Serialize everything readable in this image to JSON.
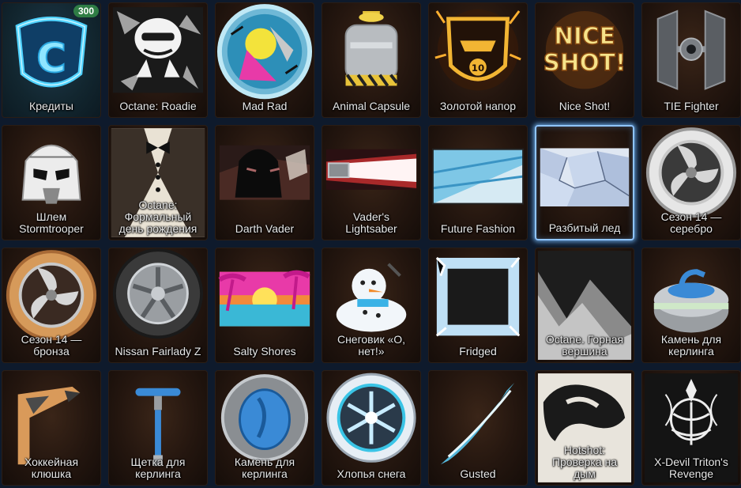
{
  "items": [
    {
      "label": "Кредиты",
      "badge": "300",
      "icon": "credits-shield-icon"
    },
    {
      "label": "Octane: Roadie",
      "icon": "roadie-decal-icon"
    },
    {
      "label": "Mad Rad",
      "icon": "mad-rad-wheel-icon"
    },
    {
      "label": "Animal Capsule",
      "icon": "animal-capsule-icon"
    },
    {
      "label": "Золотой напор",
      "icon": "golden-banner-icon"
    },
    {
      "label": "Nice Shot!",
      "icon": "nice-shot-icon"
    },
    {
      "label": "TIE Fighter",
      "icon": "tie-fighter-icon"
    },
    {
      "label": "Шлем\nStormtrooper",
      "icon": "stormtrooper-helmet-icon"
    },
    {
      "label": "Octane:\nФормальный\nдень рождения",
      "icon": "tuxedo-decal-icon"
    },
    {
      "label": "Darth Vader",
      "icon": "darth-vader-icon"
    },
    {
      "label": "Vader's\nLightsaber",
      "icon": "lightsaber-icon"
    },
    {
      "label": "Future Fashion",
      "icon": "future-fashion-icon"
    },
    {
      "label": "Разбитый лед",
      "icon": "shattered-ice-icon"
    },
    {
      "label": "Сезон 14 —\nсеребро",
      "icon": "silver-wheel-icon"
    },
    {
      "label": "Сезон 14 —\nбронза",
      "icon": "bronze-wheel-icon"
    },
    {
      "label": "Nissan Fairlady Z",
      "icon": "nissan-wheel-icon"
    },
    {
      "label": "Salty Shores",
      "icon": "salty-shores-icon"
    },
    {
      "label": "Снеговик «О,\nнет!»",
      "icon": "snowman-icon"
    },
    {
      "label": "Fridged",
      "icon": "fridged-frame-icon"
    },
    {
      "label": "Octane. Горная\nвершина",
      "icon": "mountain-decal-icon"
    },
    {
      "label": "Камень для\nкерлинга",
      "icon": "curling-stone-icon"
    },
    {
      "label": "Хоккейная\nклюшка",
      "icon": "hockey-stick-icon"
    },
    {
      "label": "Щетка для\nкерлинга",
      "icon": "curling-brush-icon"
    },
    {
      "label": "Камень для\nкерлинга",
      "icon": "curling-stone-wheel-icon"
    },
    {
      "label": "Хлопья снега",
      "icon": "snowflake-wheel-icon"
    },
    {
      "label": "Gusted",
      "icon": "gusted-icon"
    },
    {
      "label": "Hotshot:\nПроверка на\nдым",
      "icon": "hotshot-decal-icon"
    },
    {
      "label": "X-Devil Triton's\nRevenge",
      "icon": "triton-emblem-icon"
    }
  ]
}
